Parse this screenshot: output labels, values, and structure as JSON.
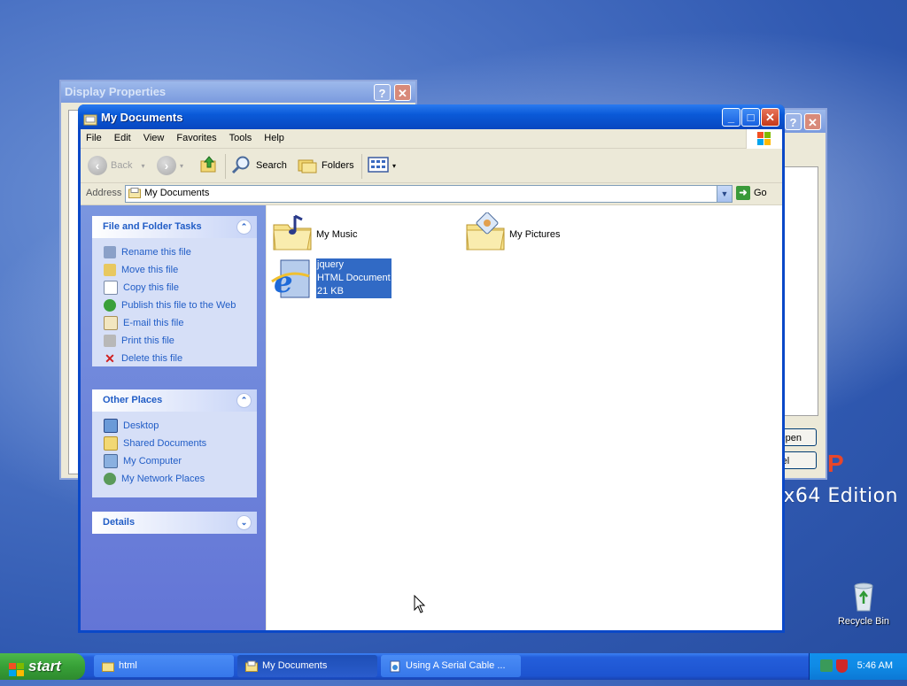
{
  "desktop": {
    "brand_text": "x64 Edition",
    "recycle_bin_label": "Recycle Bin"
  },
  "windows": {
    "display_properties": {
      "title": "Display Properties"
    },
    "background_dialog": {
      "open_button": "Open",
      "cancel_button": "Cancel"
    }
  },
  "main_window": {
    "title": "My Documents",
    "menu": [
      "File",
      "Edit",
      "View",
      "Favorites",
      "Tools",
      "Help"
    ],
    "toolbar": {
      "back": "Back",
      "search": "Search",
      "folders": "Folders"
    },
    "address": {
      "label": "Address",
      "value": "My Documents",
      "go": "Go"
    },
    "file_tasks": {
      "header": "File and Folder Tasks",
      "items": [
        "Rename this file",
        "Move this file",
        "Copy this file",
        "Publish this file to the Web",
        "E-mail this file",
        "Print this file",
        "Delete this file"
      ]
    },
    "other_places": {
      "header": "Other Places",
      "items": [
        "Desktop",
        "Shared Documents",
        "My Computer",
        "My Network Places"
      ]
    },
    "details": {
      "header": "Details"
    },
    "files": [
      {
        "name": "My Music",
        "type": "",
        "size": ""
      },
      {
        "name": "My Pictures",
        "type": "",
        "size": ""
      },
      {
        "name": "jquery",
        "type": "HTML Document",
        "size": "21 KB"
      }
    ]
  },
  "taskbar": {
    "start_label": "start",
    "tasks": [
      "html",
      "My Documents",
      "Using A Serial Cable ..."
    ],
    "clock": "5:46 AM"
  },
  "colors": {
    "title_bar": "#0a5ad8",
    "task_pane_link": "#215dc6",
    "selection": "#316ac5",
    "start_button": "#37a037"
  }
}
